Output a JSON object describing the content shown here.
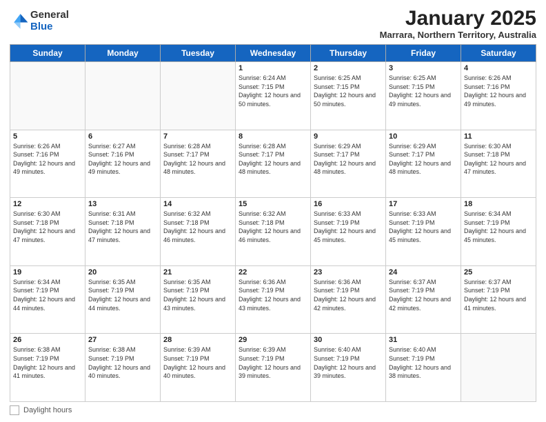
{
  "logo": {
    "general": "General",
    "blue": "Blue"
  },
  "header": {
    "title": "January 2025",
    "location": "Marrara, Northern Territory, Australia"
  },
  "weekdays": [
    "Sunday",
    "Monday",
    "Tuesday",
    "Wednesday",
    "Thursday",
    "Friday",
    "Saturday"
  ],
  "footer": {
    "label": "Daylight hours"
  },
  "weeks": [
    [
      {
        "day": "",
        "sunrise": "",
        "sunset": "",
        "daylight": ""
      },
      {
        "day": "",
        "sunrise": "",
        "sunset": "",
        "daylight": ""
      },
      {
        "day": "",
        "sunrise": "",
        "sunset": "",
        "daylight": ""
      },
      {
        "day": "1",
        "sunrise": "Sunrise: 6:24 AM",
        "sunset": "Sunset: 7:15 PM",
        "daylight": "Daylight: 12 hours and 50 minutes."
      },
      {
        "day": "2",
        "sunrise": "Sunrise: 6:25 AM",
        "sunset": "Sunset: 7:15 PM",
        "daylight": "Daylight: 12 hours and 50 minutes."
      },
      {
        "day": "3",
        "sunrise": "Sunrise: 6:25 AM",
        "sunset": "Sunset: 7:15 PM",
        "daylight": "Daylight: 12 hours and 49 minutes."
      },
      {
        "day": "4",
        "sunrise": "Sunrise: 6:26 AM",
        "sunset": "Sunset: 7:16 PM",
        "daylight": "Daylight: 12 hours and 49 minutes."
      }
    ],
    [
      {
        "day": "5",
        "sunrise": "Sunrise: 6:26 AM",
        "sunset": "Sunset: 7:16 PM",
        "daylight": "Daylight: 12 hours and 49 minutes."
      },
      {
        "day": "6",
        "sunrise": "Sunrise: 6:27 AM",
        "sunset": "Sunset: 7:16 PM",
        "daylight": "Daylight: 12 hours and 49 minutes."
      },
      {
        "day": "7",
        "sunrise": "Sunrise: 6:28 AM",
        "sunset": "Sunset: 7:17 PM",
        "daylight": "Daylight: 12 hours and 48 minutes."
      },
      {
        "day": "8",
        "sunrise": "Sunrise: 6:28 AM",
        "sunset": "Sunset: 7:17 PM",
        "daylight": "Daylight: 12 hours and 48 minutes."
      },
      {
        "day": "9",
        "sunrise": "Sunrise: 6:29 AM",
        "sunset": "Sunset: 7:17 PM",
        "daylight": "Daylight: 12 hours and 48 minutes."
      },
      {
        "day": "10",
        "sunrise": "Sunrise: 6:29 AM",
        "sunset": "Sunset: 7:17 PM",
        "daylight": "Daylight: 12 hours and 48 minutes."
      },
      {
        "day": "11",
        "sunrise": "Sunrise: 6:30 AM",
        "sunset": "Sunset: 7:18 PM",
        "daylight": "Daylight: 12 hours and 47 minutes."
      }
    ],
    [
      {
        "day": "12",
        "sunrise": "Sunrise: 6:30 AM",
        "sunset": "Sunset: 7:18 PM",
        "daylight": "Daylight: 12 hours and 47 minutes."
      },
      {
        "day": "13",
        "sunrise": "Sunrise: 6:31 AM",
        "sunset": "Sunset: 7:18 PM",
        "daylight": "Daylight: 12 hours and 47 minutes."
      },
      {
        "day": "14",
        "sunrise": "Sunrise: 6:32 AM",
        "sunset": "Sunset: 7:18 PM",
        "daylight": "Daylight: 12 hours and 46 minutes."
      },
      {
        "day": "15",
        "sunrise": "Sunrise: 6:32 AM",
        "sunset": "Sunset: 7:18 PM",
        "daylight": "Daylight: 12 hours and 46 minutes."
      },
      {
        "day": "16",
        "sunrise": "Sunrise: 6:33 AM",
        "sunset": "Sunset: 7:19 PM",
        "daylight": "Daylight: 12 hours and 45 minutes."
      },
      {
        "day": "17",
        "sunrise": "Sunrise: 6:33 AM",
        "sunset": "Sunset: 7:19 PM",
        "daylight": "Daylight: 12 hours and 45 minutes."
      },
      {
        "day": "18",
        "sunrise": "Sunrise: 6:34 AM",
        "sunset": "Sunset: 7:19 PM",
        "daylight": "Daylight: 12 hours and 45 minutes."
      }
    ],
    [
      {
        "day": "19",
        "sunrise": "Sunrise: 6:34 AM",
        "sunset": "Sunset: 7:19 PM",
        "daylight": "Daylight: 12 hours and 44 minutes."
      },
      {
        "day": "20",
        "sunrise": "Sunrise: 6:35 AM",
        "sunset": "Sunset: 7:19 PM",
        "daylight": "Daylight: 12 hours and 44 minutes."
      },
      {
        "day": "21",
        "sunrise": "Sunrise: 6:35 AM",
        "sunset": "Sunset: 7:19 PM",
        "daylight": "Daylight: 12 hours and 43 minutes."
      },
      {
        "day": "22",
        "sunrise": "Sunrise: 6:36 AM",
        "sunset": "Sunset: 7:19 PM",
        "daylight": "Daylight: 12 hours and 43 minutes."
      },
      {
        "day": "23",
        "sunrise": "Sunrise: 6:36 AM",
        "sunset": "Sunset: 7:19 PM",
        "daylight": "Daylight: 12 hours and 42 minutes."
      },
      {
        "day": "24",
        "sunrise": "Sunrise: 6:37 AM",
        "sunset": "Sunset: 7:19 PM",
        "daylight": "Daylight: 12 hours and 42 minutes."
      },
      {
        "day": "25",
        "sunrise": "Sunrise: 6:37 AM",
        "sunset": "Sunset: 7:19 PM",
        "daylight": "Daylight: 12 hours and 41 minutes."
      }
    ],
    [
      {
        "day": "26",
        "sunrise": "Sunrise: 6:38 AM",
        "sunset": "Sunset: 7:19 PM",
        "daylight": "Daylight: 12 hours and 41 minutes."
      },
      {
        "day": "27",
        "sunrise": "Sunrise: 6:38 AM",
        "sunset": "Sunset: 7:19 PM",
        "daylight": "Daylight: 12 hours and 40 minutes."
      },
      {
        "day": "28",
        "sunrise": "Sunrise: 6:39 AM",
        "sunset": "Sunset: 7:19 PM",
        "daylight": "Daylight: 12 hours and 40 minutes."
      },
      {
        "day": "29",
        "sunrise": "Sunrise: 6:39 AM",
        "sunset": "Sunset: 7:19 PM",
        "daylight": "Daylight: 12 hours and 39 minutes."
      },
      {
        "day": "30",
        "sunrise": "Sunrise: 6:40 AM",
        "sunset": "Sunset: 7:19 PM",
        "daylight": "Daylight: 12 hours and 39 minutes."
      },
      {
        "day": "31",
        "sunrise": "Sunrise: 6:40 AM",
        "sunset": "Sunset: 7:19 PM",
        "daylight": "Daylight: 12 hours and 38 minutes."
      },
      {
        "day": "",
        "sunrise": "",
        "sunset": "",
        "daylight": ""
      }
    ]
  ]
}
